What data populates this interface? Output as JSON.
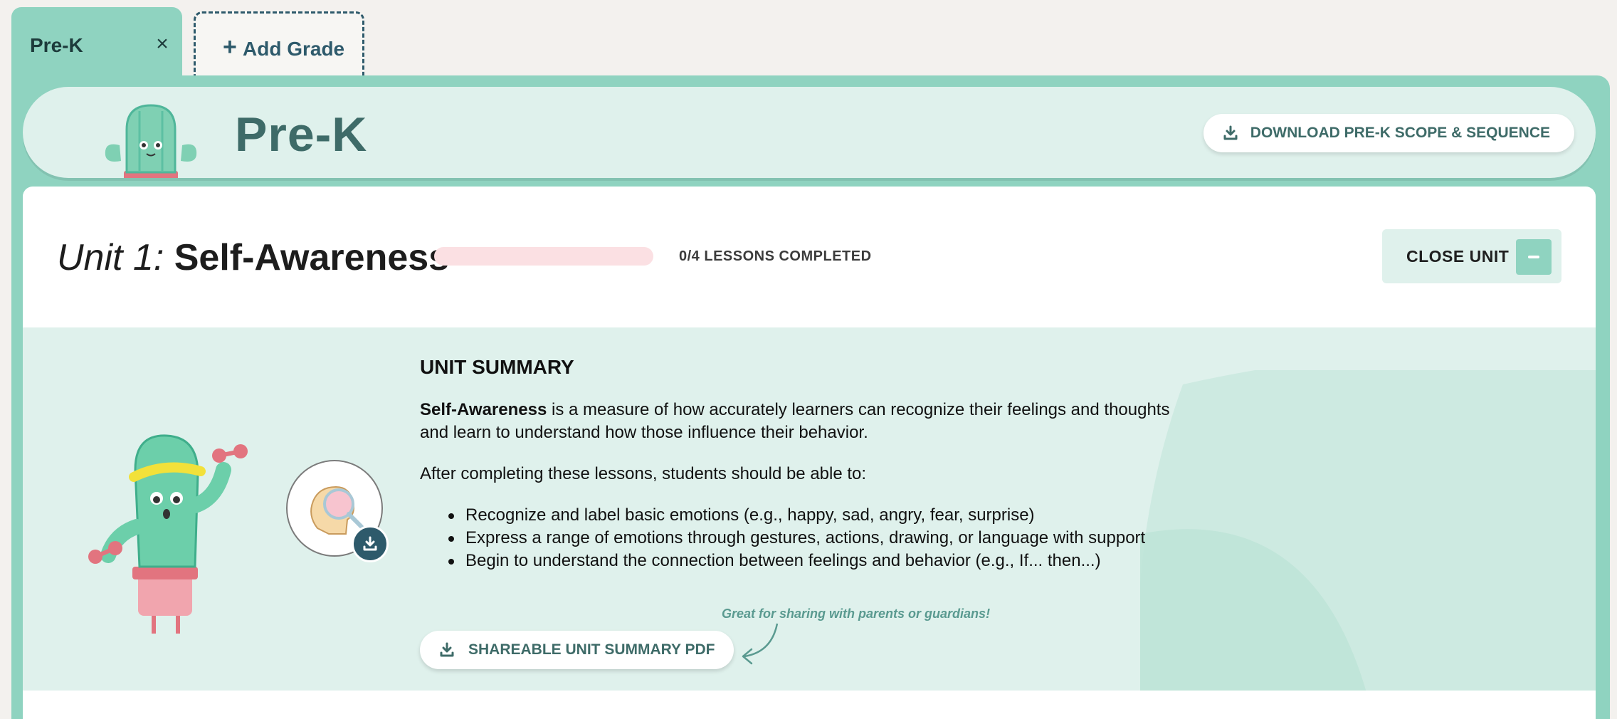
{
  "tabs": {
    "active": {
      "label": "Pre-K",
      "close": "×"
    },
    "add": {
      "plus": "+",
      "label": "Add Grade"
    }
  },
  "grade_header": {
    "title": "Pre-K",
    "download_label": "DOWNLOAD PRE-K SCOPE & SEQUENCE"
  },
  "unit": {
    "number_label": "Unit 1:",
    "name": "Self-Awareness",
    "progress_fraction": 0,
    "progress_text": "0/4 LESSONS COMPLETED",
    "close_label": "CLOSE UNIT"
  },
  "summary": {
    "heading": "UNIT SUMMARY",
    "intro_bold": "Self-Awareness",
    "intro_rest": " is a measure of how accurately learners can recognize their feelings and thoughts and learn to understand how those influence their behavior.",
    "lead_in": "After completing these lessons, students should be able to:",
    "outcomes": [
      "Recognize and label basic emotions (e.g., happy, sad, angry, fear, surprise)",
      "Express a range of emotions through gestures, actions, drawing, or language with support",
      "Begin to understand the connection between feelings and behavior (e.g., If... then...)"
    ],
    "pdf_label": "SHAREABLE UNIT SUMMARY PDF",
    "pdf_note": "Great for sharing with parents or guardians!"
  },
  "colors": {
    "accent": "#8fd3c0",
    "accent_light": "#dff1ec",
    "header_text": "#3e6b68",
    "navy": "#2e5a6b",
    "progress_track": "#fbe0e3"
  }
}
